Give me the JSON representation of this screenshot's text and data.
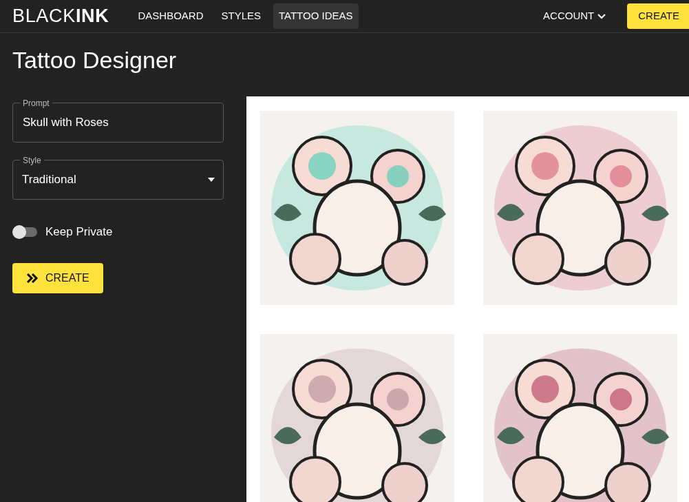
{
  "header": {
    "logo": "BLACK**INK**",
    "nav": [
      {
        "label": "DASHBOARD",
        "selected": false
      },
      {
        "label": "STYLES",
        "selected": false
      },
      {
        "label": "TATTOO IDEAS",
        "selected": true
      }
    ],
    "account": {
      "label": "ACCOUNT"
    },
    "create_button": "CREATE"
  },
  "title": "Tattoo Designer",
  "form": {
    "prompt": {
      "label": "Prompt",
      "value": "Skull with Roses"
    },
    "style": {
      "label": "Style",
      "value": "Traditional"
    },
    "keep_private": {
      "label": "Keep Private",
      "on": false
    },
    "create_button": "CREATE"
  }
}
